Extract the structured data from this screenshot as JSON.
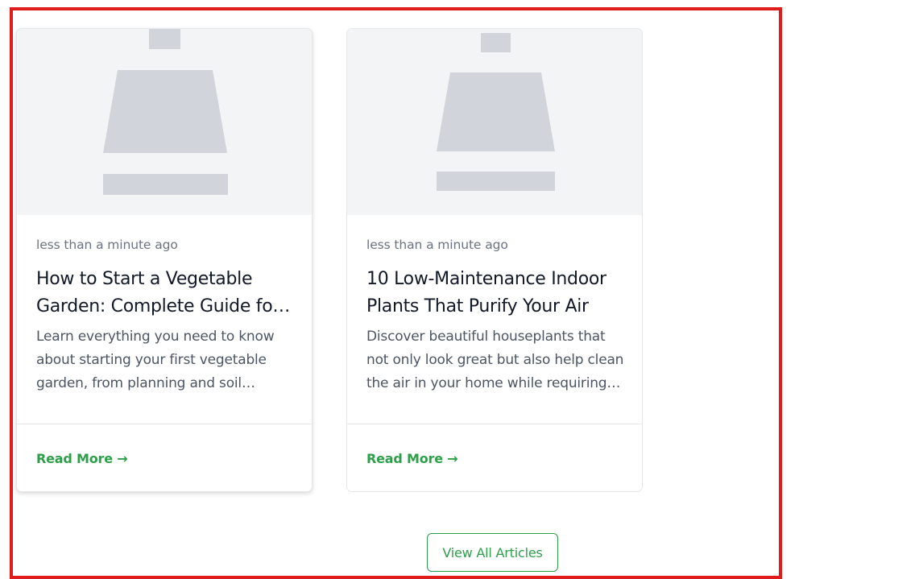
{
  "colors": {
    "frame_border": "#e01b1b",
    "accent_green": "#2e9e4a",
    "placeholder_bg": "#f3f4f6",
    "placeholder_shape": "#d1d5db"
  },
  "articles": [
    {
      "image_icon": "image-placeholder-icon",
      "date": "less than a minute ago",
      "title": "How to Start a Vegetable Garden: Complete Guide for Beginners",
      "excerpt": "Learn everything you need to know about starting your first vegetable garden, from planning and soil preparation to harvesting.",
      "read_more_label": "Read More →"
    },
    {
      "image_icon": "image-placeholder-icon",
      "date": "less than a minute ago",
      "title": "10 Low-Maintenance Indoor Plants That Purify Your Air",
      "excerpt": "Discover beautiful houseplants that not only look great but also help clean the air in your home while requiring minimal care.",
      "read_more_label": "Read More →"
    }
  ],
  "view_all_label": "View All Articles"
}
